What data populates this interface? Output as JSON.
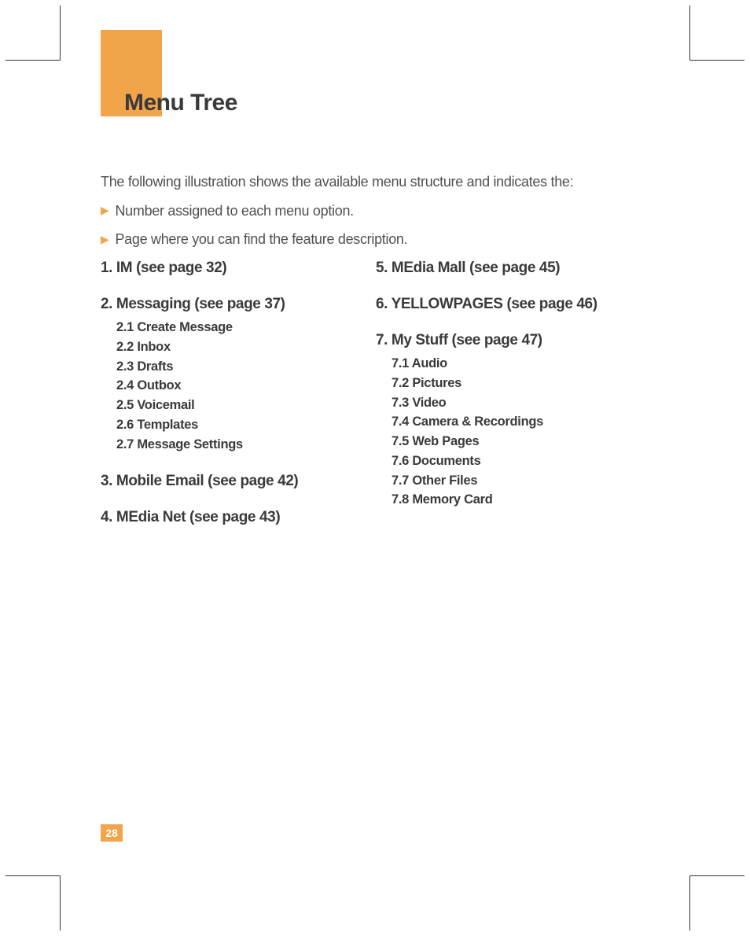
{
  "title": "Menu Tree",
  "intro": "The following illustration shows the available menu structure and indicates the:",
  "bullets": [
    "Number assigned to each menu option.",
    "Page where you can find the feature description."
  ],
  "left_sections": [
    {
      "title": "1. IM (see page 32)",
      "items": []
    },
    {
      "title": "2. Messaging (see page 37)",
      "items": [
        "2.1 Create Message",
        "2.2 Inbox",
        "2.3 Drafts",
        "2.4 Outbox",
        "2.5 Voicemail",
        "2.6 Templates",
        "2.7 Message Settings"
      ]
    },
    {
      "title": "3. Mobile Email (see page 42)",
      "items": []
    },
    {
      "title": "4. MEdia Net (see page 43)",
      "items": []
    }
  ],
  "right_sections": [
    {
      "title": "5. MEdia Mall (see page 45)",
      "items": []
    },
    {
      "title": "6. YELLOWPAGES (see page 46)",
      "items": []
    },
    {
      "title": "7. My Stuff (see page 47)",
      "items": [
        "7.1 Audio",
        "7.2 Pictures",
        "7.3 Video",
        "7.4 Camera & Recordings",
        "7.5 Web Pages",
        "7.6 Documents",
        "7.7 Other Files",
        "7.8 Memory Card"
      ]
    }
  ],
  "page_number": "28"
}
